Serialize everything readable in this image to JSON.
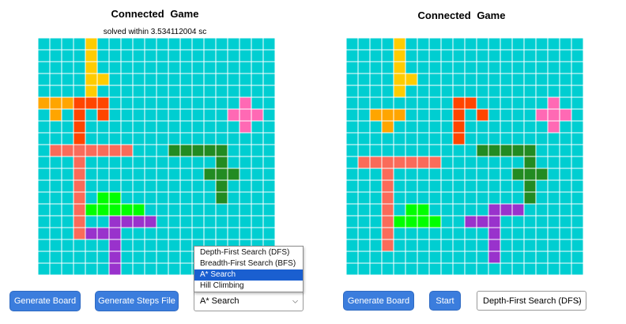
{
  "left": {
    "title": "Connected  Game",
    "subtitle": "solved within 3.534112004 sc",
    "buttons": {
      "generate_board": "Generate Board",
      "generate_steps": "Generate Steps File"
    },
    "select": {
      "value": "A* Search"
    },
    "dropdown_options": [
      "Depth-First Search (DFS)",
      "Breadth-First Search (BFS)",
      "A* Search",
      "Hill Climbing"
    ],
    "dropdown_selected_index": 2
  },
  "right": {
    "title": "Connected  Game",
    "buttons": {
      "generate_board": "Generate Board",
      "start": "Start"
    },
    "select": {
      "value": "Depth-First Search (DFS)"
    }
  },
  "colors": {
    "board_bg": "#00ced1",
    "grid_line": "#ffffff",
    "yellow": "#ffcc00",
    "orange": "#ffa500",
    "red_orange": "#ff4500",
    "pink": "#ff69b4",
    "salmon": "#fa6b5a",
    "dark_green": "#228b22",
    "lime": "#00ff00",
    "purple": "#9932cc",
    "button": "#3b7ddd"
  },
  "boards": {
    "left": {
      "size": 20,
      "pieces": [
        {
          "color": "yellow",
          "cells": [
            [
              0,
              4
            ],
            [
              1,
              4
            ],
            [
              2,
              4
            ],
            [
              3,
              4
            ],
            [
              3,
              5
            ],
            [
              4,
              4
            ],
            [
              5,
              4
            ]
          ]
        },
        {
          "color": "orange",
          "cells": [
            [
              5,
              0
            ],
            [
              5,
              1
            ],
            [
              5,
              2
            ],
            [
              6,
              1
            ]
          ]
        },
        {
          "color": "red_orange",
          "cells": [
            [
              5,
              3
            ],
            [
              5,
              4
            ],
            [
              5,
              5
            ],
            [
              6,
              3
            ],
            [
              6,
              5
            ],
            [
              7,
              3
            ],
            [
              8,
              3
            ]
          ]
        },
        {
          "color": "pink",
          "cells": [
            [
              5,
              17
            ],
            [
              6,
              16
            ],
            [
              6,
              17
            ],
            [
              6,
              18
            ],
            [
              7,
              17
            ]
          ]
        },
        {
          "color": "salmon",
          "cells": [
            [
              9,
              1
            ],
            [
              9,
              2
            ],
            [
              9,
              3
            ],
            [
              9,
              4
            ],
            [
              9,
              5
            ],
            [
              9,
              6
            ],
            [
              9,
              7
            ],
            [
              10,
              3
            ],
            [
              11,
              3
            ],
            [
              12,
              3
            ],
            [
              13,
              3
            ],
            [
              14,
              3
            ],
            [
              15,
              3
            ],
            [
              16,
              3
            ]
          ]
        },
        {
          "color": "dark_green",
          "cells": [
            [
              9,
              11
            ],
            [
              9,
              12
            ],
            [
              9,
              13
            ],
            [
              9,
              14
            ],
            [
              9,
              15
            ],
            [
              10,
              15
            ],
            [
              11,
              14
            ],
            [
              11,
              15
            ],
            [
              11,
              16
            ],
            [
              12,
              15
            ],
            [
              13,
              15
            ]
          ]
        },
        {
          "color": "lime",
          "cells": [
            [
              13,
              5
            ],
            [
              13,
              6
            ],
            [
              14,
              4
            ],
            [
              14,
              5
            ],
            [
              14,
              6
            ],
            [
              14,
              7
            ],
            [
              14,
              8
            ]
          ]
        },
        {
          "color": "purple",
          "cells": [
            [
              15,
              6
            ],
            [
              15,
              7
            ],
            [
              15,
              8
            ],
            [
              15,
              9
            ],
            [
              16,
              4
            ],
            [
              16,
              5
            ],
            [
              16,
              6
            ],
            [
              17,
              6
            ],
            [
              18,
              6
            ],
            [
              19,
              6
            ]
          ]
        }
      ]
    },
    "right": {
      "size": 20,
      "pieces": [
        {
          "color": "yellow",
          "cells": [
            [
              0,
              4
            ],
            [
              1,
              4
            ],
            [
              2,
              4
            ],
            [
              3,
              4
            ],
            [
              3,
              5
            ],
            [
              4,
              4
            ]
          ]
        },
        {
          "color": "orange",
          "cells": [
            [
              6,
              2
            ],
            [
              6,
              3
            ],
            [
              6,
              4
            ],
            [
              7,
              3
            ]
          ]
        },
        {
          "color": "red_orange",
          "cells": [
            [
              5,
              9
            ],
            [
              5,
              10
            ],
            [
              6,
              9
            ],
            [
              6,
              11
            ],
            [
              7,
              9
            ],
            [
              8,
              9
            ]
          ]
        },
        {
          "color": "pink",
          "cells": [
            [
              5,
              17
            ],
            [
              6,
              16
            ],
            [
              6,
              17
            ],
            [
              6,
              18
            ],
            [
              7,
              17
            ]
          ]
        },
        {
          "color": "dark_green",
          "cells": [
            [
              9,
              11
            ],
            [
              9,
              12
            ],
            [
              9,
              13
            ],
            [
              9,
              14
            ],
            [
              9,
              15
            ],
            [
              10,
              15
            ],
            [
              11,
              14
            ],
            [
              11,
              15
            ],
            [
              11,
              16
            ],
            [
              12,
              15
            ],
            [
              13,
              15
            ]
          ]
        },
        {
          "color": "salmon",
          "cells": [
            [
              10,
              1
            ],
            [
              10,
              2
            ],
            [
              10,
              3
            ],
            [
              10,
              4
            ],
            [
              10,
              5
            ],
            [
              10,
              6
            ],
            [
              10,
              7
            ],
            [
              11,
              3
            ],
            [
              12,
              3
            ],
            [
              13,
              3
            ],
            [
              14,
              3
            ],
            [
              15,
              3
            ],
            [
              16,
              3
            ],
            [
              17,
              3
            ]
          ]
        },
        {
          "color": "lime",
          "cells": [
            [
              14,
              5
            ],
            [
              14,
              6
            ],
            [
              15,
              4
            ],
            [
              15,
              5
            ],
            [
              15,
              6
            ],
            [
              15,
              7
            ]
          ]
        },
        {
          "color": "purple",
          "cells": [
            [
              14,
              12
            ],
            [
              14,
              13
            ],
            [
              14,
              14
            ],
            [
              15,
              10
            ],
            [
              15,
              11
            ],
            [
              15,
              12
            ],
            [
              16,
              12
            ],
            [
              17,
              12
            ],
            [
              18,
              12
            ]
          ]
        }
      ]
    }
  }
}
